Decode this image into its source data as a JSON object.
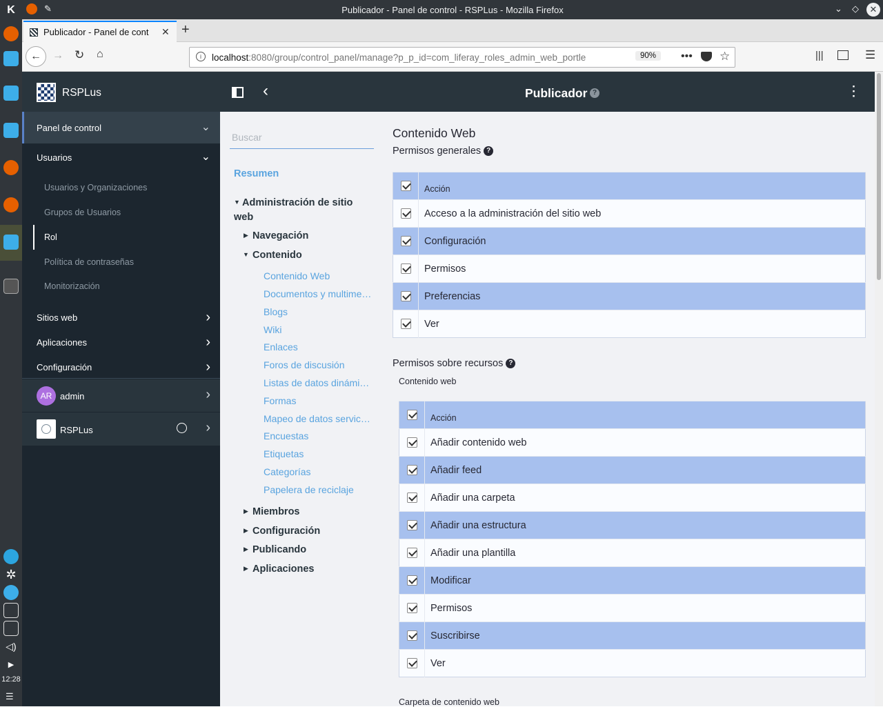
{
  "window": {
    "title": "Publicador - Panel de control - RSPLus - Mozilla Firefox"
  },
  "taskbar": {
    "clock": "12:28"
  },
  "browser": {
    "tab_title": "Publicador - Panel de cont",
    "url_host": "localhost",
    "url_rest": ":8080/group/control_panel/manage?p_p_id=com_liferay_roles_admin_web_portle",
    "zoom": "90%"
  },
  "sidebar": {
    "brand": "RSPLus",
    "panel": "Panel de control",
    "usuarios": "Usuarios",
    "sub_items": [
      "Usuarios y Organizaciones",
      "Grupos de Usuarios",
      "Rol",
      "Política de contraseñas",
      "Monitorización"
    ],
    "sitios": "Sitios web",
    "aplicaciones": "Aplicaciones",
    "configuracion": "Configuración",
    "user_initials": "AR",
    "user_name": "admin",
    "site_name": "RSPLus"
  },
  "header": {
    "title": "Publicador",
    "help": "?"
  },
  "tree": {
    "search_placeholder": "Buscar",
    "resumen": "Resumen",
    "admin_line1": "Administración de sitio",
    "admin_line2": "web",
    "navegacion": "Navegación",
    "contenido": "Contenido",
    "links": [
      "Contenido Web",
      "Documentos y multime…",
      "Blogs",
      "Wiki",
      "Enlaces",
      "Foros de discusión",
      "Listas de datos dinámi…",
      "Formas",
      "Mapeo de datos servic…",
      "Encuestas",
      "Etiquetas",
      "Categorías",
      "Papelera de reciclaje"
    ],
    "miembros": "Miembros",
    "configuracion": "Configuración",
    "publicando": "Publicando",
    "aplicaciones": "Aplicaciones"
  },
  "main": {
    "section_title": "Contenido Web",
    "general_title": "Permisos generales",
    "general_header": "Acción",
    "general_rows": [
      "Acceso a la administración del sitio web",
      "Configuración",
      "Permisos",
      "Preferencias",
      "Ver"
    ],
    "resource_title": "Permisos sobre recursos",
    "resource_sub": "Contenido web",
    "resource_header": "Acción",
    "resource_rows": [
      "Añadir contenido web",
      "Añadir feed",
      "Añadir una carpeta",
      "Añadir una estructura",
      "Añadir una plantilla",
      "Modificar",
      "Permisos",
      "Suscribirse",
      "Ver"
    ],
    "next_sub": "Carpeta de contenido web"
  }
}
